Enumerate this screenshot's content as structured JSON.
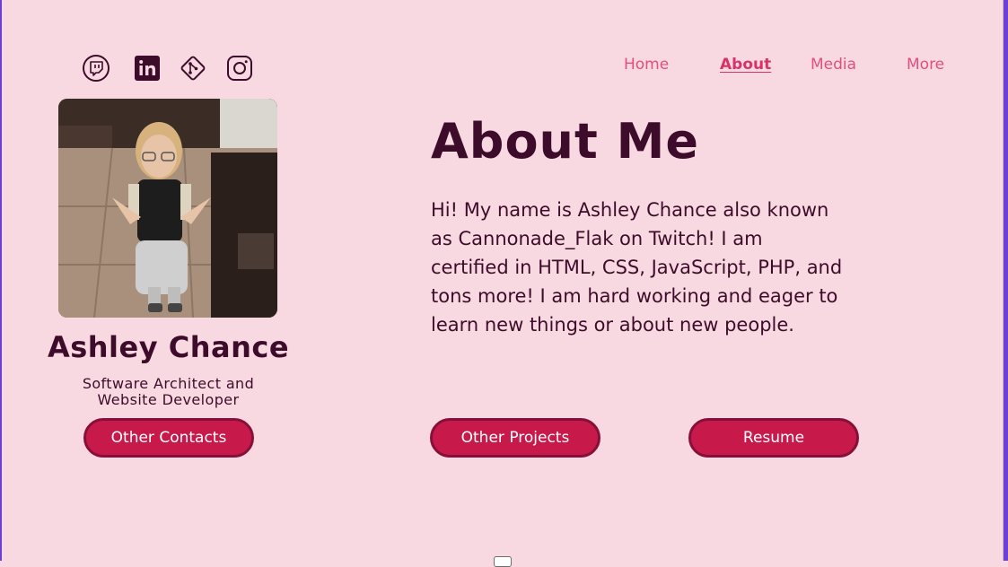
{
  "nav": {
    "items": [
      {
        "label": "Home",
        "active": false
      },
      {
        "label": "About",
        "active": true
      },
      {
        "label": "Media",
        "active": false
      },
      {
        "label": "More",
        "active": false
      }
    ]
  },
  "social": {
    "icons": [
      "twitch-icon",
      "linkedin-icon",
      "git-icon",
      "instagram-icon"
    ]
  },
  "profile": {
    "name": "Ashley Chance",
    "role": "Software Architect and Website Developer",
    "contacts_button": "Other Contacts"
  },
  "about": {
    "title": "About Me",
    "text": "Hi! My name is Ashley Chance also known as Cannonade_Flak on Twitch!  I am certified in HTML, CSS, JavaScript, PHP, and tons more!  I am hard working and eager to learn new things or about new people."
  },
  "buttons": {
    "projects": "Other Projects",
    "resume": "Resume"
  },
  "colors": {
    "background": "#f9d9e1",
    "text": "#3d0c2a",
    "nav": "#e04f7e",
    "button": "#c8194b",
    "button_border": "#87103a",
    "frame": "#6c3fd6"
  }
}
